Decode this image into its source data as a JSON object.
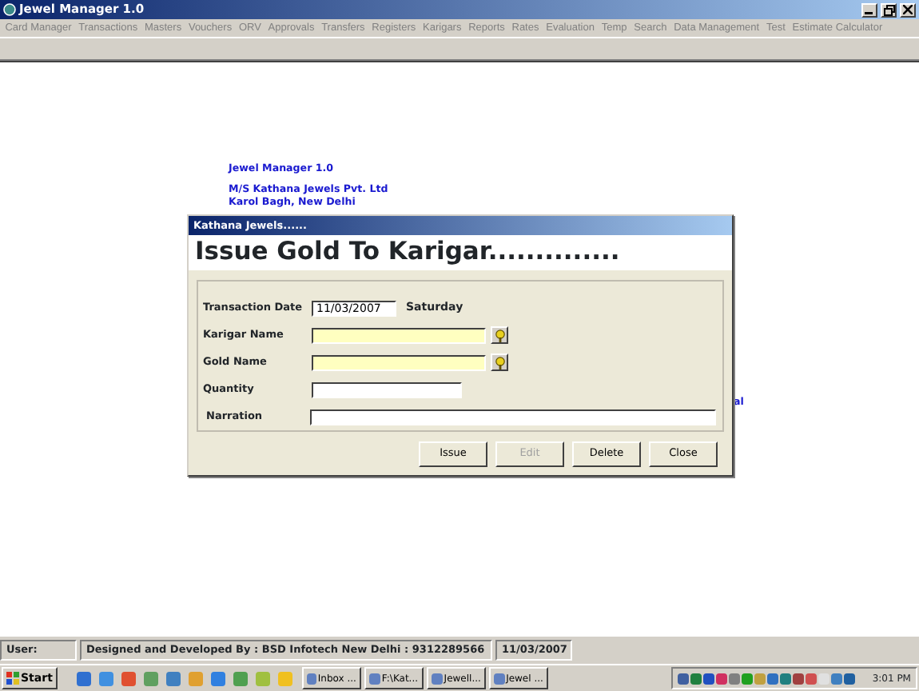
{
  "window": {
    "title": "Jewel Manager 1.0"
  },
  "menu": [
    {
      "label": "Card Manager",
      "disabled": true
    },
    {
      "label": "Transactions",
      "disabled": true
    },
    {
      "label": "Masters",
      "disabled": true
    },
    {
      "label": "Vouchers",
      "disabled": true
    },
    {
      "label": "ORV",
      "disabled": true
    },
    {
      "label": "Approvals",
      "disabled": true
    },
    {
      "label": "Transfers",
      "disabled": true
    },
    {
      "label": "Registers",
      "disabled": true
    },
    {
      "label": "Karigars",
      "disabled": true
    },
    {
      "label": "Reports",
      "disabled": true
    },
    {
      "label": "Rates",
      "disabled": true
    },
    {
      "label": "Evaluation",
      "disabled": true
    },
    {
      "label": "Temp",
      "disabled": true
    },
    {
      "label": "Search",
      "disabled": true
    },
    {
      "label": "Data Management",
      "disabled": true
    },
    {
      "label": "Test",
      "disabled": true
    },
    {
      "label": "Estimate Calculator",
      "disabled": true
    }
  ],
  "background": {
    "app_name": "Jewel Manager 1.0",
    "company": "M/S Kathana Jewels Pvt. Ltd",
    "address": "Karol Bagh, New Delhi",
    "fragment": "al"
  },
  "dialog": {
    "title": "Kathana Jewels......",
    "heading": "Issue Gold To Karigar..............",
    "fields": [
      {
        "label": "Transaction Date",
        "kind": "date",
        "value": "11/03/2007",
        "day": "Saturday"
      },
      {
        "label": "Karigar Name",
        "kind": "lookup"
      },
      {
        "label": "Gold Name",
        "kind": "lookup"
      },
      {
        "label": "Quantity",
        "kind": "short"
      },
      {
        "label": "Narration",
        "kind": "long"
      }
    ],
    "buttons": [
      {
        "label": "Issue",
        "disabled": false
      },
      {
        "label": "Edit",
        "disabled": true
      },
      {
        "label": "Delete",
        "disabled": false
      },
      {
        "label": "Close",
        "disabled": false
      }
    ]
  },
  "status_bar": [
    "User:",
    "Designed and Developed By : BSD Infotech New Delhi : 9312289566",
    "11/03/2007"
  ],
  "taskbar": {
    "start": "Start",
    "tasks": [
      "Inbox ...",
      "F:\\Kat...",
      "Jewell...",
      "Jewel ..."
    ],
    "clock": "3:01 PM"
  }
}
